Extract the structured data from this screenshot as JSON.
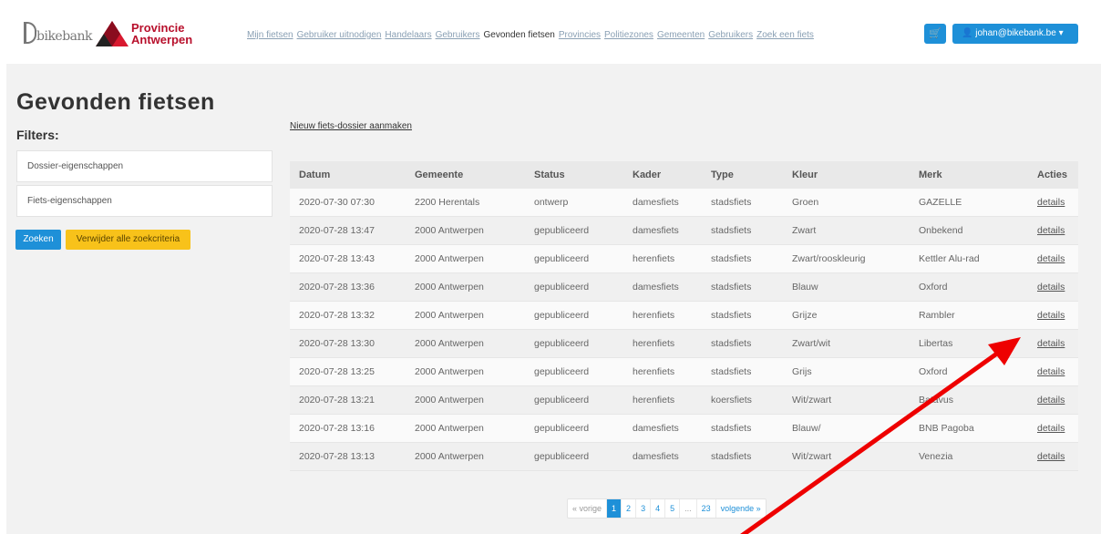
{
  "header": {
    "logo_bikebank_text": "bikebank",
    "logo_prov_line1": "Provincie",
    "logo_prov_line2": "Antwerpen",
    "nav": [
      {
        "label": "Mijn fietsen",
        "active": false
      },
      {
        "label": "Gebruiker uitnodigen",
        "active": false
      },
      {
        "label": "Handelaars",
        "active": false
      },
      {
        "label": "Gebruikers",
        "active": false
      },
      {
        "label": "Gevonden fietsen",
        "active": true
      },
      {
        "label": "Provincies",
        "active": false
      },
      {
        "label": "Politiezones",
        "active": false
      },
      {
        "label": "Gemeenten",
        "active": false
      },
      {
        "label": "Gebruikers",
        "active": false
      },
      {
        "label": "Zoek een fiets",
        "active": false
      }
    ],
    "cart_icon": "basket-icon",
    "user_label": "johan@bikebank.be"
  },
  "page": {
    "title": "Gevonden fietsen",
    "filters_label": "Filters:",
    "filters": [
      "Dossier-eigenschappen",
      "Fiets-eigenschappen"
    ],
    "search_button": "Zoeken",
    "clear_button": "Verwijder alle zoekcriteria",
    "new_dossier_link": "Nieuw fiets-dossier aanmaken"
  },
  "table": {
    "headers": [
      "Datum",
      "Gemeente",
      "Status",
      "Kader",
      "Type",
      "Kleur",
      "Merk",
      "Acties"
    ],
    "rows": [
      [
        "2020-07-30 07:30",
        "2200 Herentals",
        "ontwerp",
        "damesfiets",
        "stadsfiets",
        "Groen",
        "GAZELLE",
        "details"
      ],
      [
        "2020-07-28 13:47",
        "2000 Antwerpen",
        "gepubliceerd",
        "damesfiets",
        "stadsfiets",
        "Zwart",
        "Onbekend",
        "details"
      ],
      [
        "2020-07-28 13:43",
        "2000 Antwerpen",
        "gepubliceerd",
        "herenfiets",
        "stadsfiets",
        "Zwart/rooskleurig",
        "Kettler Alu-rad",
        "details"
      ],
      [
        "2020-07-28 13:36",
        "2000 Antwerpen",
        "gepubliceerd",
        "damesfiets",
        "stadsfiets",
        "Blauw",
        "Oxford",
        "details"
      ],
      [
        "2020-07-28 13:32",
        "2000 Antwerpen",
        "gepubliceerd",
        "herenfiets",
        "stadsfiets",
        "Grijze",
        "Rambler",
        "details"
      ],
      [
        "2020-07-28 13:30",
        "2000 Antwerpen",
        "gepubliceerd",
        "herenfiets",
        "stadsfiets",
        "Zwart/wit",
        "Libertas",
        "details"
      ],
      [
        "2020-07-28 13:25",
        "2000 Antwerpen",
        "gepubliceerd",
        "herenfiets",
        "stadsfiets",
        "Grijs",
        "Oxford",
        "details"
      ],
      [
        "2020-07-28 13:21",
        "2000 Antwerpen",
        "gepubliceerd",
        "herenfiets",
        "koersfiets",
        "Wit/zwart",
        "Batavus",
        "details"
      ],
      [
        "2020-07-28 13:16",
        "2000 Antwerpen",
        "gepubliceerd",
        "damesfiets",
        "stadsfiets",
        "Blauw/",
        "BNB Pagoba",
        "details"
      ],
      [
        "2020-07-28 13:13",
        "2000 Antwerpen",
        "gepubliceerd",
        "damesfiets",
        "stadsfiets",
        "Wit/zwart",
        "Venezia",
        "details"
      ]
    ]
  },
  "pagination": {
    "prev": "« vorige",
    "pages": [
      "1",
      "2",
      "3",
      "4",
      "5",
      "...",
      "23"
    ],
    "active": "1",
    "next": "volgende »"
  },
  "colors": {
    "primary": "#1e90d8",
    "warning": "#f8c21a",
    "brand_red": "#b8102c",
    "arrow": "#ee0000"
  }
}
